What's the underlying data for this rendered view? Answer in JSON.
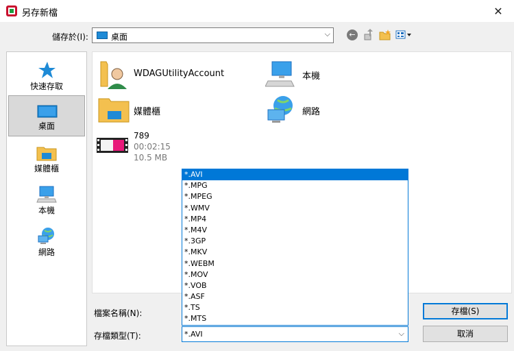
{
  "window": {
    "title": "另存新檔",
    "close_glyph": "✕"
  },
  "location": {
    "label": "儲存於(I):",
    "current": "桌面"
  },
  "toolbar": {
    "back_glyph": "←",
    "up_glyph": "⇧",
    "newfolder_glyph": "✦",
    "view_glyph": "▦▾"
  },
  "places": [
    {
      "label": "快速存取",
      "icon": "star-icon"
    },
    {
      "label": "桌面",
      "icon": "desktop-icon",
      "selected": true
    },
    {
      "label": "媒體櫃",
      "icon": "library-icon"
    },
    {
      "label": "本機",
      "icon": "computer-icon"
    },
    {
      "label": "網路",
      "icon": "network-icon"
    }
  ],
  "files": {
    "user": {
      "name": "WDAGUtilityAccount",
      "icon": "user-folder-icon"
    },
    "computer": {
      "name": "本機",
      "icon": "computer-icon"
    },
    "libraries": {
      "name": "媒體櫃",
      "icon": "library-folder-icon"
    },
    "network": {
      "name": "網路",
      "icon": "network-icon"
    },
    "video": {
      "name": "789",
      "duration": "00:02:15",
      "size": "10.5 MB",
      "icon": "video-thumbnail-icon"
    }
  },
  "form": {
    "filename_label": "檔案名稱(N):",
    "filename_value": "",
    "type_label": "存檔類型(T):",
    "type_value": "*.AVI"
  },
  "buttons": {
    "save": "存檔(S)",
    "cancel": "取消"
  },
  "file_types": [
    "*.AVI",
    "*.MPG",
    "*.MPEG",
    "*.WMV",
    "*.MP4",
    "*.M4V",
    "*.3GP",
    "*.MKV",
    "*.WEBM",
    "*.MOV",
    "*.VOB",
    "*.ASF",
    "*.TS",
    "*.MTS"
  ],
  "colors": {
    "accent": "#0078d7",
    "folder": "#f3c04f",
    "app_red": "#c8102e",
    "app_green": "#1a9e3f"
  }
}
